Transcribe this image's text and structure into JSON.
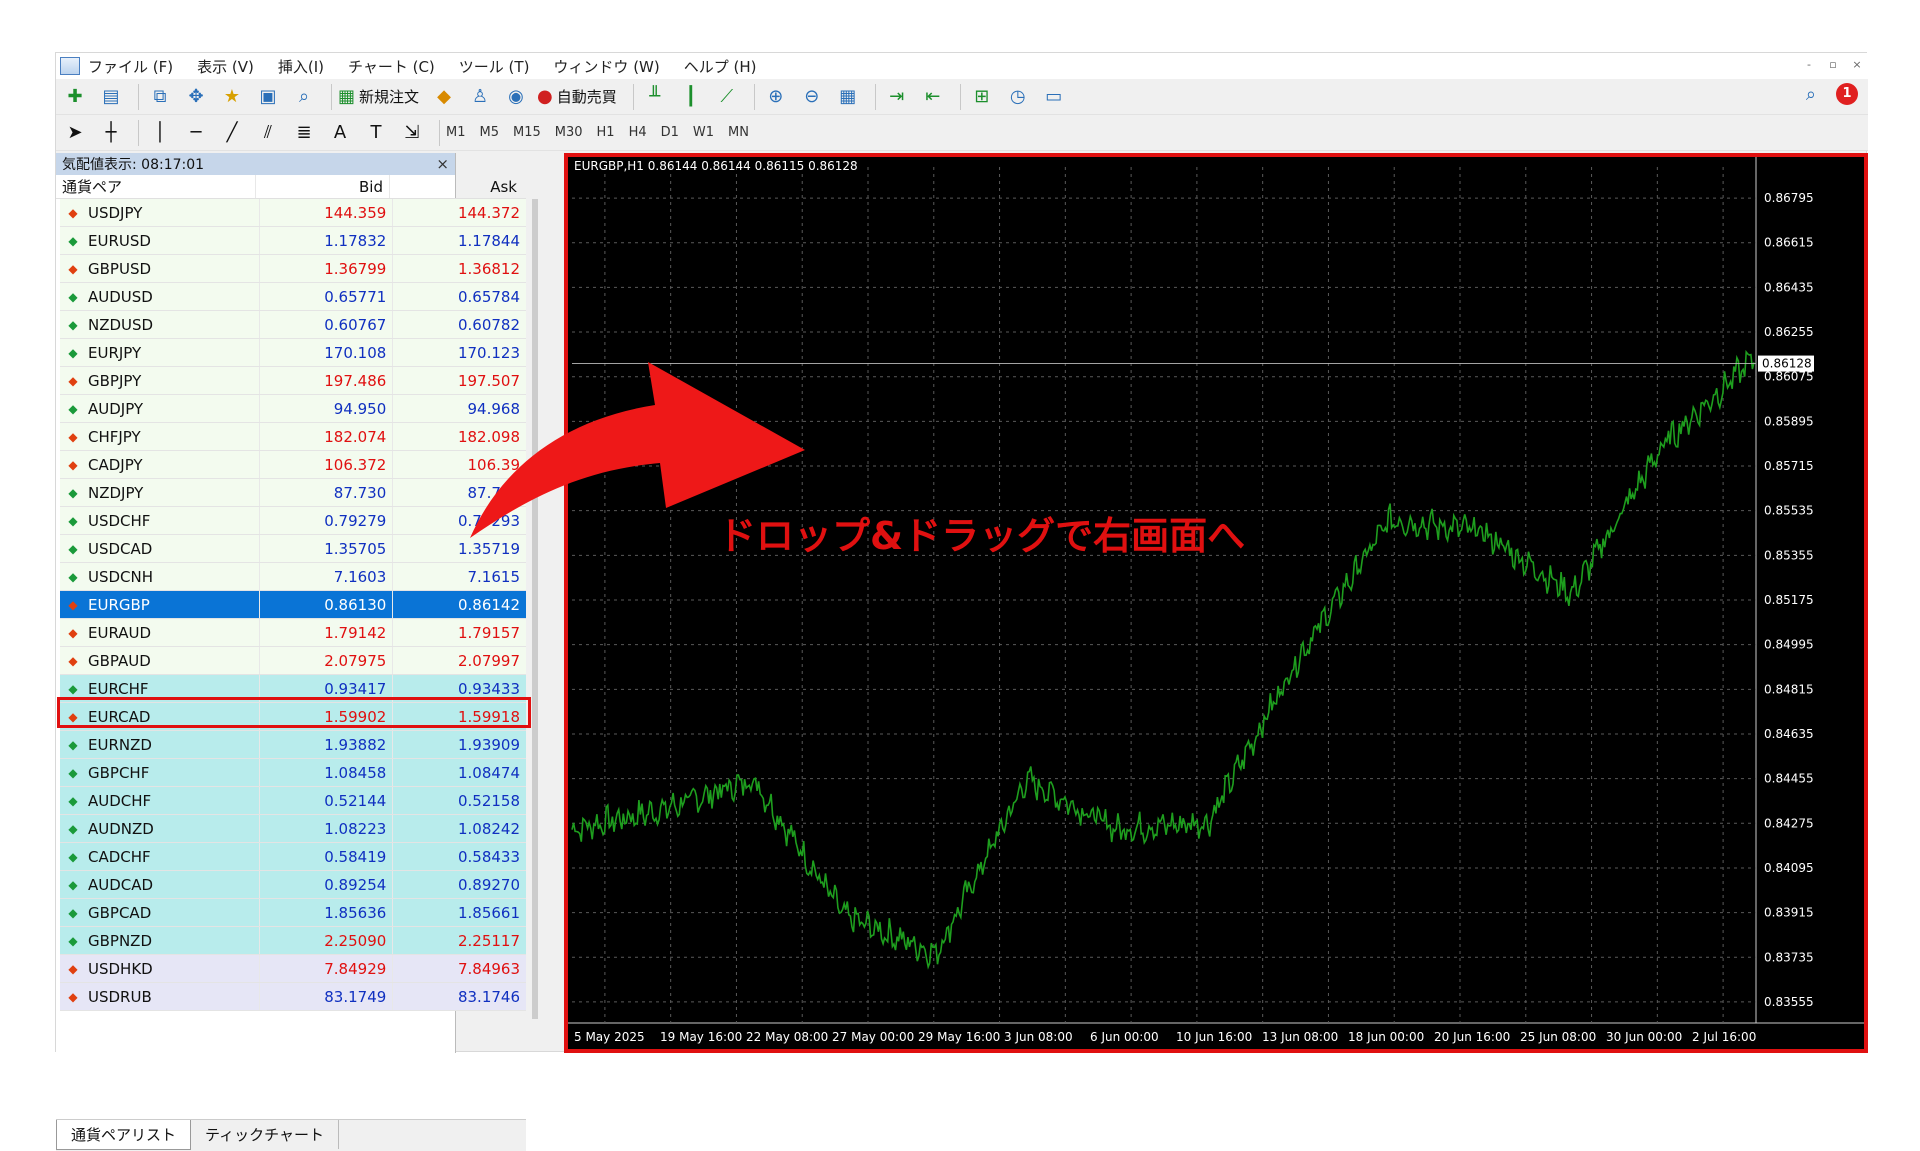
{
  "menu": [
    "ファイル (F)",
    "表示 (V)",
    "挿入(I)",
    "チャート (C)",
    "ツール (T)",
    "ウィンドウ (W)",
    "ヘルプ (H)"
  ],
  "window_controls": [
    "-",
    "▫",
    "×"
  ],
  "toolbar1": {
    "new_order": "新規注文",
    "auto_trade": "自動売買",
    "notification_count": "1"
  },
  "timeframes": [
    "M1",
    "M5",
    "M15",
    "M30",
    "H1",
    "H4",
    "D1",
    "W1",
    "MN"
  ],
  "market_watch": {
    "header": "気配値表示: 08:17:01",
    "close": "×",
    "col_symbol": "通貨ペア",
    "col_bid": "Bid",
    "col_ask": "Ask",
    "rows": [
      {
        "symbol": "USDJPY",
        "bid": "144.359",
        "ask": "144.372",
        "dir": "down",
        "color": "red",
        "bg": "green"
      },
      {
        "symbol": "EURUSD",
        "bid": "1.17832",
        "ask": "1.17844",
        "dir": "up",
        "color": "blue",
        "bg": "green"
      },
      {
        "symbol": "GBPUSD",
        "bid": "1.36799",
        "ask": "1.36812",
        "dir": "down",
        "color": "red",
        "bg": "green"
      },
      {
        "symbol": "AUDUSD",
        "bid": "0.65771",
        "ask": "0.65784",
        "dir": "up",
        "color": "blue",
        "bg": "green"
      },
      {
        "symbol": "NZDUSD",
        "bid": "0.60767",
        "ask": "0.60782",
        "dir": "up",
        "color": "blue",
        "bg": "green"
      },
      {
        "symbol": "EURJPY",
        "bid": "170.108",
        "ask": "170.123",
        "dir": "up",
        "color": "blue",
        "bg": "green"
      },
      {
        "symbol": "GBPJPY",
        "bid": "197.486",
        "ask": "197.507",
        "dir": "down",
        "color": "red",
        "bg": "green"
      },
      {
        "symbol": "AUDJPY",
        "bid": "94.950",
        "ask": "94.968",
        "dir": "up",
        "color": "blue",
        "bg": "green"
      },
      {
        "symbol": "CHFJPY",
        "bid": "182.074",
        "ask": "182.098",
        "dir": "down",
        "color": "red",
        "bg": "green"
      },
      {
        "symbol": "CADJPY",
        "bid": "106.372",
        "ask": "106.39",
        "dir": "down",
        "color": "red",
        "bg": "green"
      },
      {
        "symbol": "NZDJPY",
        "bid": "87.730",
        "ask": "87.746",
        "dir": "up",
        "color": "blue",
        "bg": "green"
      },
      {
        "symbol": "USDCHF",
        "bid": "0.79279",
        "ask": "0.79293",
        "dir": "up",
        "color": "blue",
        "bg": "green"
      },
      {
        "symbol": "USDCAD",
        "bid": "1.35705",
        "ask": "1.35719",
        "dir": "up",
        "color": "blue",
        "bg": "green"
      },
      {
        "symbol": "USDCNH",
        "bid": "7.1603",
        "ask": "7.1615",
        "dir": "up",
        "color": "blue",
        "bg": "green"
      },
      {
        "symbol": "EURGBP",
        "bid": "0.86130",
        "ask": "0.86142",
        "dir": "down",
        "color": "blue",
        "bg": "sel"
      },
      {
        "symbol": "EURAUD",
        "bid": "1.79142",
        "ask": "1.79157",
        "dir": "down",
        "color": "red",
        "bg": "green"
      },
      {
        "symbol": "GBPAUD",
        "bid": "2.07975",
        "ask": "2.07997",
        "dir": "down",
        "color": "red",
        "bg": "green"
      },
      {
        "symbol": "EURCHF",
        "bid": "0.93417",
        "ask": "0.93433",
        "dir": "up",
        "color": "blue",
        "bg": "cyan"
      },
      {
        "symbol": "EURCAD",
        "bid": "1.59902",
        "ask": "1.59918",
        "dir": "down",
        "color": "red",
        "bg": "cyan"
      },
      {
        "symbol": "EURNZD",
        "bid": "1.93882",
        "ask": "1.93909",
        "dir": "up",
        "color": "blue",
        "bg": "cyan"
      },
      {
        "symbol": "GBPCHF",
        "bid": "1.08458",
        "ask": "1.08474",
        "dir": "up",
        "color": "blue",
        "bg": "cyan"
      },
      {
        "symbol": "AUDCHF",
        "bid": "0.52144",
        "ask": "0.52158",
        "dir": "up",
        "color": "blue",
        "bg": "cyan"
      },
      {
        "symbol": "AUDNZD",
        "bid": "1.08223",
        "ask": "1.08242",
        "dir": "up",
        "color": "blue",
        "bg": "cyan"
      },
      {
        "symbol": "CADCHF",
        "bid": "0.58419",
        "ask": "0.58433",
        "dir": "up",
        "color": "blue",
        "bg": "cyan"
      },
      {
        "symbol": "AUDCAD",
        "bid": "0.89254",
        "ask": "0.89270",
        "dir": "up",
        "color": "blue",
        "bg": "cyan"
      },
      {
        "symbol": "GBPCAD",
        "bid": "1.85636",
        "ask": "1.85661",
        "dir": "up",
        "color": "blue",
        "bg": "cyan"
      },
      {
        "symbol": "GBPNZD",
        "bid": "2.25090",
        "ask": "2.25117",
        "dir": "up",
        "color": "red",
        "bg": "cyan"
      },
      {
        "symbol": "USDHKD",
        "bid": "7.84929",
        "ask": "7.84963",
        "dir": "down",
        "color": "red",
        "bg": "lav"
      },
      {
        "symbol": "USDRUB",
        "bid": "83.1749",
        "ask": "83.1746",
        "dir": "down",
        "color": "blue",
        "bg": "lav"
      }
    ],
    "tabs": [
      "通貨ペアリスト",
      "ティックチャート"
    ]
  },
  "chart": {
    "title": "EURGBP,H1  0.86144 0.86144 0.86115 0.86128",
    "current_price": "0.86128",
    "price_labels": [
      "0.86795",
      "0.86615",
      "0.86435",
      "0.86255",
      "0.86075",
      "0.85895",
      "0.85715",
      "0.85535",
      "0.85355",
      "0.85175",
      "0.84995",
      "0.84815",
      "0.84635",
      "0.84455",
      "0.84275",
      "0.84095",
      "0.83915",
      "0.83735",
      "0.83555"
    ],
    "time_labels": [
      "5 May 2025",
      "19 May 16:00",
      "22 May 08:00",
      "27 May 00:00",
      "29 May 16:00",
      "3 Jun 08:00",
      "6 Jun 00:00",
      "10 Jun 16:00",
      "13 Jun 08:00",
      "18 Jun 00:00",
      "20 Jun 16:00",
      "25 Jun 08:00",
      "30 Jun 00:00",
      "2 Jul 16:00"
    ],
    "line_color": "#1e9e1e",
    "grid_color": "#5a5a5a"
  },
  "chart_data": {
    "type": "line",
    "title": "EURGBP,H1  0.86144 0.86144 0.86115 0.86128",
    "xlabel": "",
    "ylabel": "",
    "ylim": [
      0.8347,
      0.8688
    ],
    "grid": true,
    "x": [
      "5 May 2025",
      "19 May 16:00",
      "22 May 08:00",
      "27 May 00:00",
      "29 May 16:00",
      "3 Jun 08:00",
      "6 Jun 00:00",
      "10 Jun 16:00",
      "13 Jun 08:00",
      "18 Jun 00:00",
      "20 Jun 16:00",
      "25 Jun 08:00",
      "30 Jun 00:00",
      "2 Jul 16:00"
    ],
    "series": [
      {
        "values": [
          0.8425,
          0.8433,
          0.8445,
          0.839,
          0.8375,
          0.8445,
          0.8425,
          0.8428,
          0.8495,
          0.855,
          0.8545,
          0.852,
          0.858,
          0.8615
        ]
      }
    ],
    "current_price": 0.86128
  },
  "annotation": {
    "text": "ドロップ&ドラッグで右画面へ",
    "color": "#e01010"
  }
}
